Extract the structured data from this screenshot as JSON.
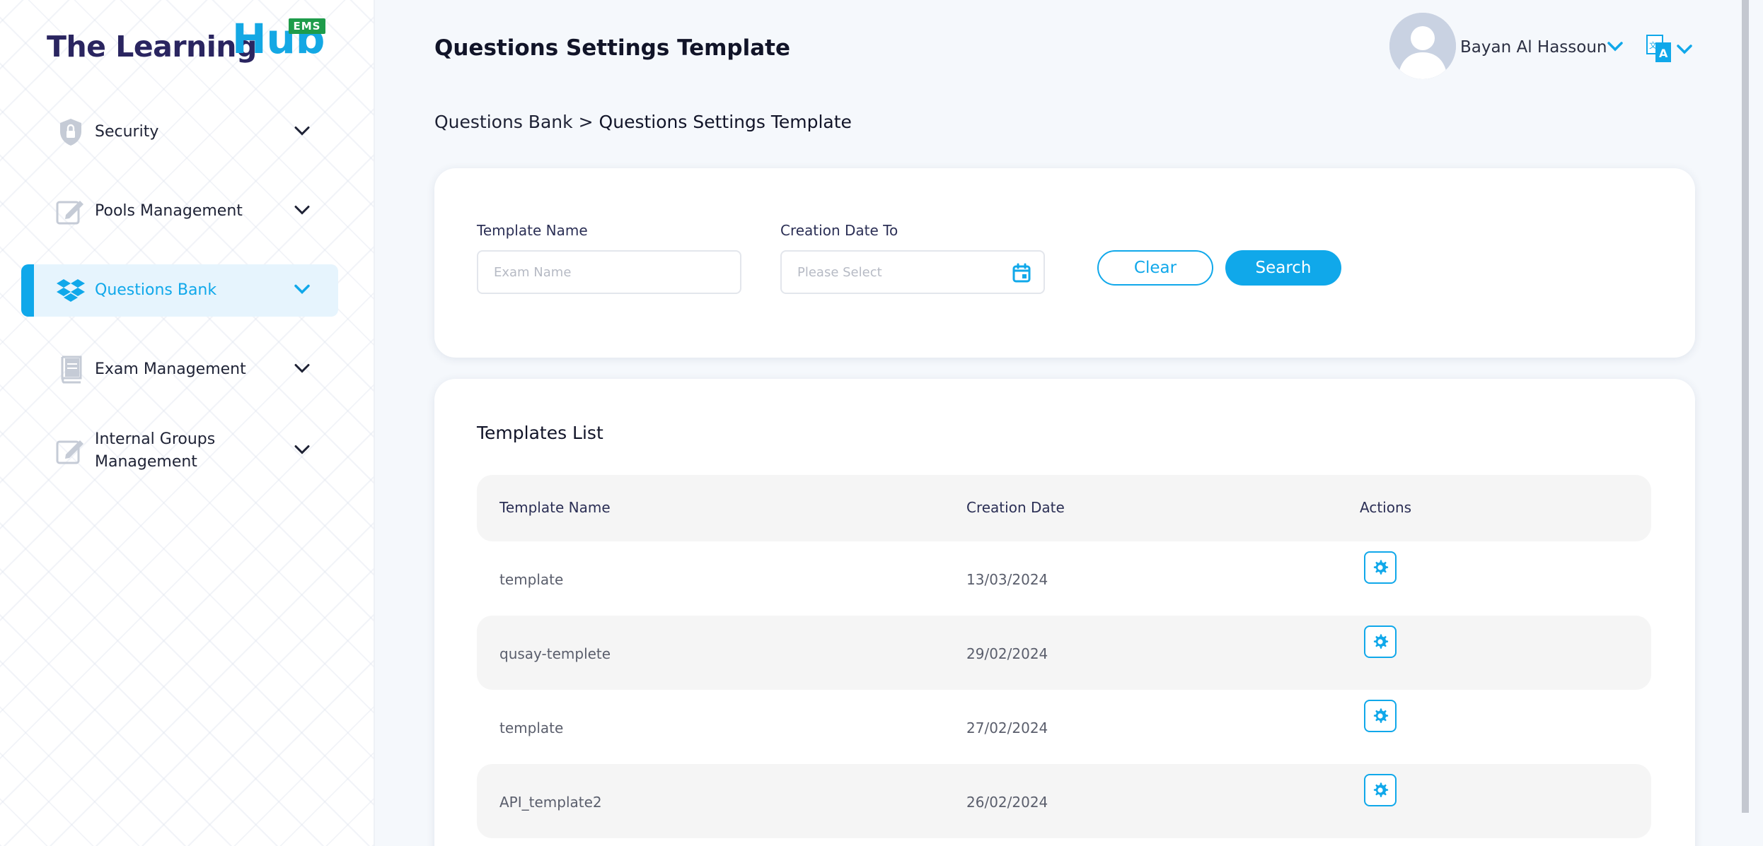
{
  "brand": {
    "logo_main": "The Learning ",
    "logo_hub": "Hub",
    "logo_badge": "EMS"
  },
  "sidebar": {
    "items": [
      {
        "label": "Security",
        "icon": "shield-lock-icon",
        "active": false
      },
      {
        "label": "Pools Management",
        "icon": "edit-icon",
        "active": false
      },
      {
        "label": "Questions Bank",
        "icon": "dropbox-icon",
        "active": true
      },
      {
        "label": "Exam Management",
        "icon": "book-icon",
        "active": false
      },
      {
        "label": "Internal Groups Management",
        "icon": "edit-icon",
        "active": false
      }
    ]
  },
  "header": {
    "title": "Questions Settings Template",
    "user_name": "Bayan Al Hassoun"
  },
  "breadcrumb": {
    "parent": "Questions Bank",
    "separator": ">",
    "current": "Questions Settings Template"
  },
  "filters": {
    "template_name_label": "Template Name",
    "template_name_placeholder": "Exam Name",
    "creation_date_label": "Creation Date To",
    "creation_date_placeholder": "Please Select",
    "clear_label": "Clear",
    "search_label": "Search"
  },
  "templates": {
    "title": "Templates List",
    "columns": [
      "Template Name",
      "Creation Date",
      "Actions"
    ],
    "rows": [
      {
        "name": "template",
        "date": "13/03/2024"
      },
      {
        "name": "qusay-templete",
        "date": "29/02/2024"
      },
      {
        "name": "template",
        "date": "27/02/2024"
      },
      {
        "name": "API_template2",
        "date": "26/02/2024"
      }
    ]
  },
  "colors": {
    "accent": "#10a8ea",
    "brand_dark": "#2a2560",
    "badge_green": "#1e9c4a"
  }
}
